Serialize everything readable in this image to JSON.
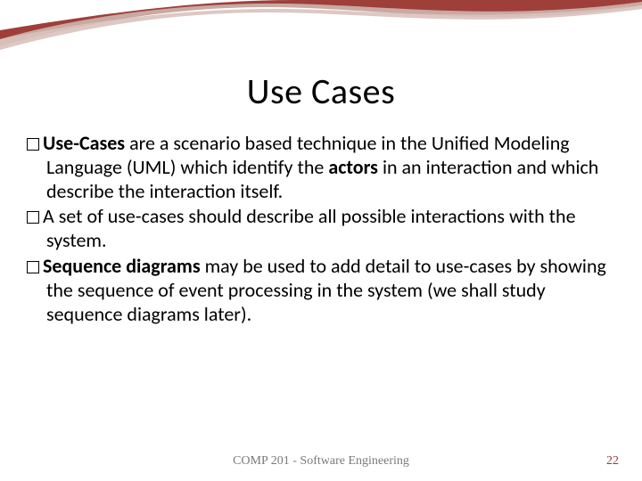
{
  "title": "Use Cases",
  "bullets": [
    {
      "bold1": "Use-Cases",
      "t1": " are a scenario based technique in the Unified Modeling Language (UML) which identify the ",
      "bold2": "actors",
      "t2": " in an interaction and which describe the interaction itself."
    },
    {
      "t1": "A set of use-cases should describe all possible interactions with the system."
    },
    {
      "bold1": "Sequence diagrams",
      "t1": " may be used to add detail to use-cases by showing the sequence of event processing in the system (we shall study sequence diagrams later)."
    }
  ],
  "footer_center": "COMP 201 - Software Engineering",
  "footer_right": "22"
}
